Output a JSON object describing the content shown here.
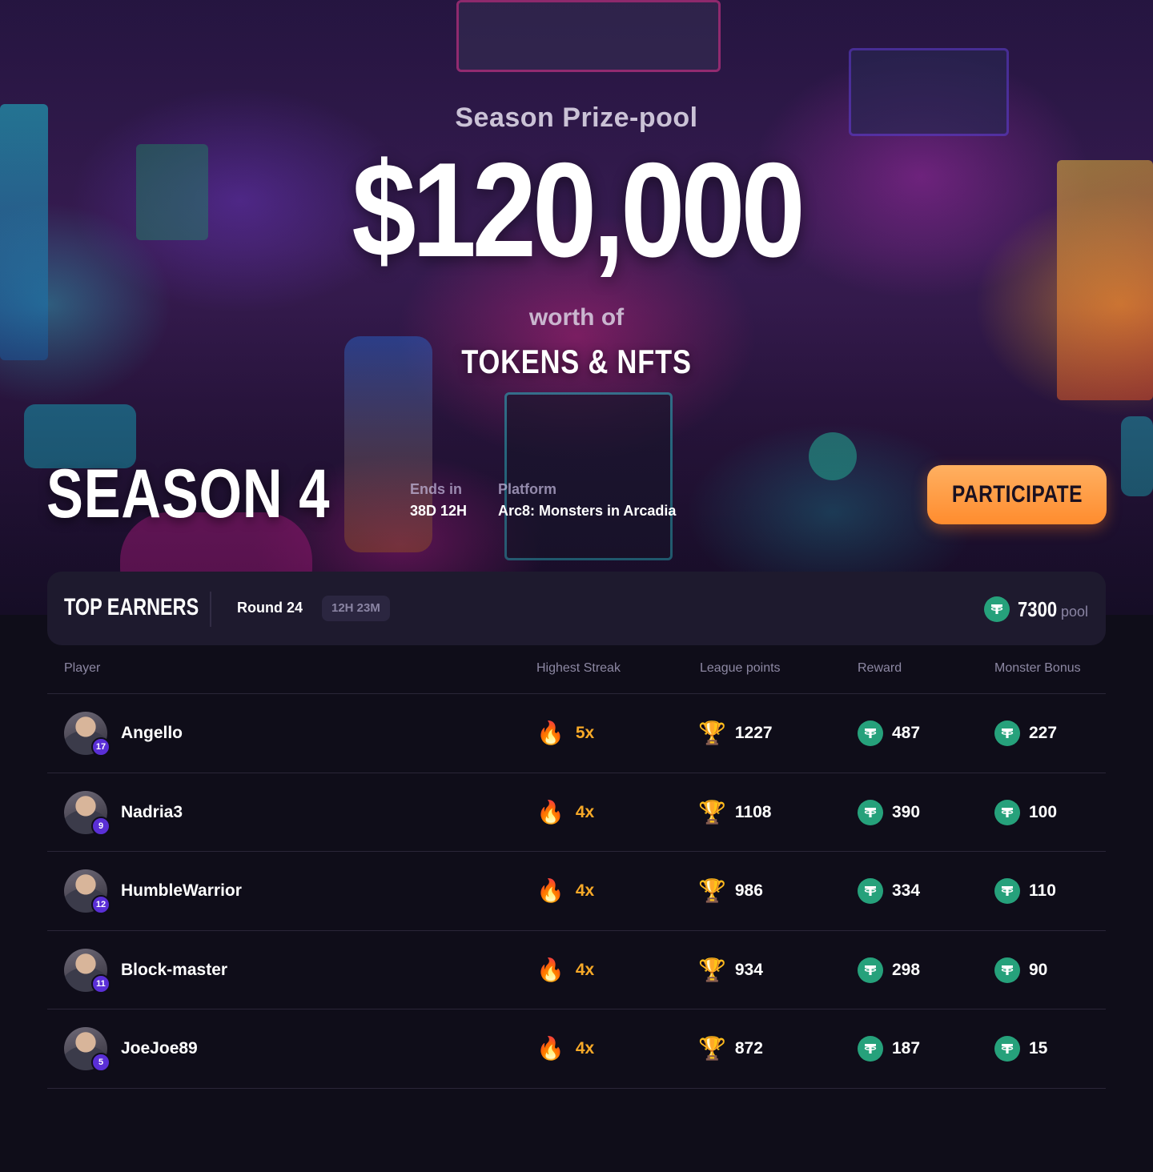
{
  "hero": {
    "prize_label": "Season Prize-pool",
    "prize_amount": "$120,000",
    "worth_of": "worth of",
    "tokens_nfts": "TOKENS & NFTS",
    "season": "SEASON 4",
    "ends_in_label": "Ends in",
    "ends_in_value": "38D 12H",
    "platform_label": "Platform",
    "platform_value": "Arc8: Monsters in Arcadia",
    "participate_label": "PARTICIPATE"
  },
  "earners": {
    "title": "TOP EARNERS",
    "round": "Round 24",
    "timer": "12H 23M",
    "pool_amount": "7300",
    "pool_label": "pool"
  },
  "table": {
    "headers": {
      "player": "Player",
      "streak": "Highest Streak",
      "league": "League points",
      "reward": "Reward",
      "bonus": "Monster Bonus"
    },
    "rows": [
      {
        "name": "Angello",
        "level": "17",
        "streak": "5x",
        "league": "1227",
        "reward": "487",
        "bonus": "227"
      },
      {
        "name": "Nadria3",
        "level": "9",
        "streak": "4x",
        "league": "1108",
        "reward": "390",
        "bonus": "100"
      },
      {
        "name": "HumbleWarrior",
        "level": "12",
        "streak": "4x",
        "league": "986",
        "reward": "334",
        "bonus": "110"
      },
      {
        "name": "Block-master",
        "level": "11",
        "streak": "4x",
        "league": "934",
        "reward": "298",
        "bonus": "90"
      },
      {
        "name": "JoeJoe89",
        "level": "5",
        "streak": "4x",
        "league": "872",
        "reward": "187",
        "bonus": "15"
      }
    ]
  },
  "icons": {
    "streak": "fire-icon",
    "league": "trophy-icon",
    "currency": "tether-icon"
  },
  "colors": {
    "accent_orange": "#ff8c2e",
    "streak_text": "#f7a928",
    "tether_green": "#26a17b",
    "level_badge": "#5a2fd6",
    "page_bg": "#0f0d19"
  }
}
